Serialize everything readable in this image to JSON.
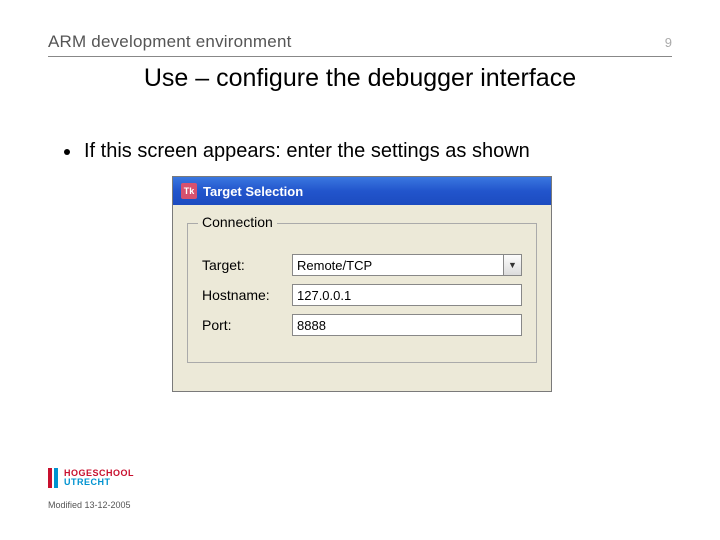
{
  "header": {
    "title": "ARM development environment",
    "page_number": "9"
  },
  "slide": {
    "subtitle": "Use – configure the debugger interface",
    "bullet": "If this screen appears: enter the settings as shown"
  },
  "dialog": {
    "icon_text": "Tk",
    "title": "Target Selection",
    "fieldset_legend": "Connection",
    "rows": {
      "target": {
        "label": "Target:",
        "value": "Remote/TCP"
      },
      "hostname": {
        "label": "Hostname:",
        "value": "127.0.0.1"
      },
      "port": {
        "label": "Port:",
        "value": "8888"
      }
    },
    "dropdown_glyph": "▼"
  },
  "footer": {
    "logo_line1": "HOGESCHOOL",
    "logo_line2": "UTRECHT",
    "modified": "Modified 13-12-2005"
  }
}
